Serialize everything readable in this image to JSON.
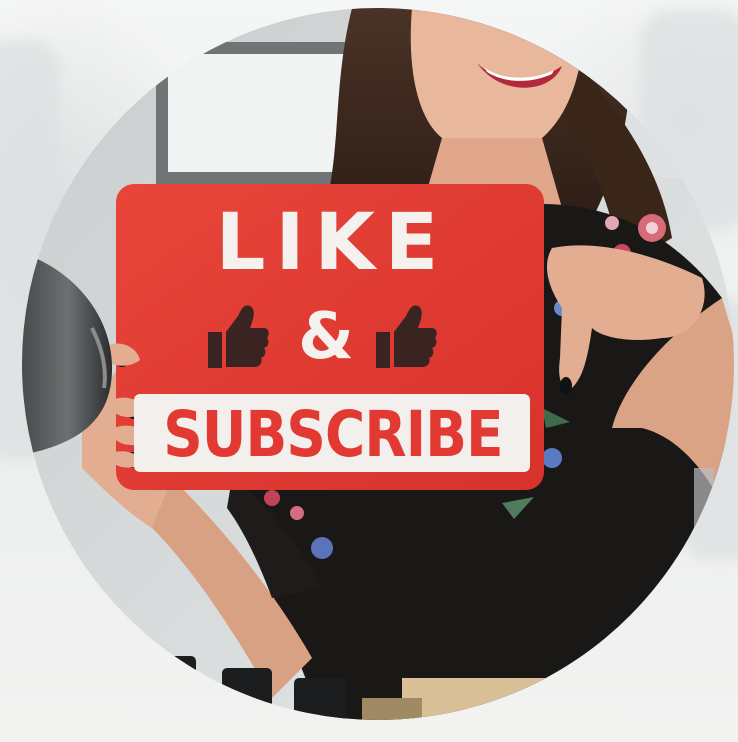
{
  "sign": {
    "line1": "LIKE",
    "line2": "&",
    "line3": "SUBSCRIBE"
  },
  "colors": {
    "sign_red": "#e23a33",
    "sign_text": "#f4f1ee",
    "shirt": "#1a1717",
    "background": "#f3f4f4"
  },
  "icons": [
    "thumbs-up-icon",
    "thumbs-up-icon"
  ]
}
